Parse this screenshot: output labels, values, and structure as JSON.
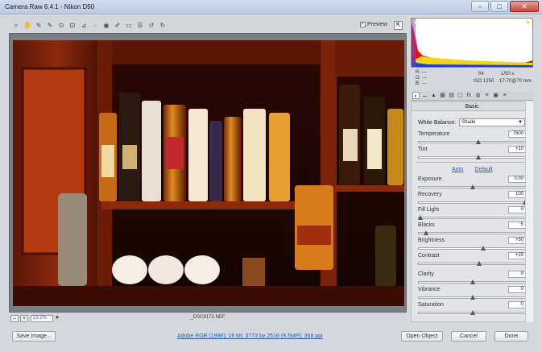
{
  "window": {
    "title": "Camera Raw 6.4.1  -  Nikon D90",
    "min_label": "–",
    "max_label": "□",
    "close_label": "✕"
  },
  "toolbar": {
    "tools": [
      "zoom-icon",
      "hand-icon",
      "white-balance-icon",
      "color-sampler-icon",
      "target-adjust-icon",
      "crop-icon",
      "straighten-icon",
      "spot-removal-icon",
      "red-eye-icon",
      "adjustment-brush-icon",
      "graduated-filter-icon",
      "preferences-icon",
      "rotate-ccw-icon",
      "rotate-cw-icon"
    ],
    "glyphs": [
      "⌕",
      "✋",
      "✎",
      "✎",
      "⊙",
      "⊡",
      "⊿",
      "◌",
      "◉",
      "✐",
      "▭",
      "☰",
      "↺",
      "↻"
    ],
    "preview_label": "Preview",
    "preview_check": "✓",
    "fullscreen_glyph": "⇱"
  },
  "image_bottom": {
    "zoom_minus": "–",
    "zoom_plus": "+",
    "zoom_value": "23.2%",
    "zoom_arrow": "▼",
    "filename": "_DSC8172.NEF"
  },
  "camera_info": {
    "r_label": "R:",
    "g_label": "G:",
    "b_label": "B:",
    "r_value": "---",
    "g_value": "---",
    "b_value": "---",
    "aperture": "f/4",
    "shutter": "1/50 s",
    "iso": "ISO 1250",
    "lens": "17-70@70 mm"
  },
  "panel": {
    "tabs": [
      "basic-icon",
      "tone-curve-icon",
      "detail-icon",
      "hsl-icon",
      "split-toning-icon",
      "lens-corrections-icon",
      "effects-icon",
      "camera-calibration-icon",
      "presets-icon",
      "snapshots-icon",
      "panel-menu-icon"
    ],
    "tab_glyphs": [
      "◐",
      "⚊",
      "▲",
      "▦",
      "▤",
      "▢",
      "fx",
      "◍",
      "≡",
      "▣",
      "≡"
    ],
    "title": "Basic",
    "white_balance_label": "White Balance:",
    "white_balance_value": "Shade",
    "white_balance_arrow": "▼",
    "auto_label": "Auto",
    "default_label": "Default",
    "sliders_wb": [
      {
        "label": "Temperature",
        "value": "7500",
        "pos": 0.55
      },
      {
        "label": "Tint",
        "value": "+10",
        "pos": 0.55
      }
    ],
    "sliders_tone": [
      {
        "label": "Exposure",
        "value": "0.00",
        "pos": 0.5
      },
      {
        "label": "Recovery",
        "value": "100",
        "pos": 1.0
      },
      {
        "label": "Fill Light",
        "value": "0",
        "pos": 0.0
      },
      {
        "label": "Blacks",
        "value": "5",
        "pos": 0.05
      },
      {
        "label": "Brightness",
        "value": "+50",
        "pos": 0.6
      },
      {
        "label": "Contrast",
        "value": "+25",
        "pos": 0.56
      }
    ],
    "sliders_presence": [
      {
        "label": "Clarity",
        "value": "0",
        "pos": 0.5
      },
      {
        "label": "Vibrance",
        "value": "0",
        "pos": 0.5
      },
      {
        "label": "Saturation",
        "value": "0",
        "pos": 0.5
      }
    ]
  },
  "footer": {
    "save_label": "Save Image...",
    "info": "Adobe RGB (1998); 16 bit; 3773 by 2516 (9.5MP); 358 ppi",
    "open_label": "Open Object",
    "cancel_label": "Cancel",
    "done_label": "Done"
  },
  "colors": {
    "histogram_red": "#e0151b",
    "histogram_yellow": "#f2d21b",
    "histogram_blue": "#1b3fd6",
    "link": "#2f5aa8"
  }
}
